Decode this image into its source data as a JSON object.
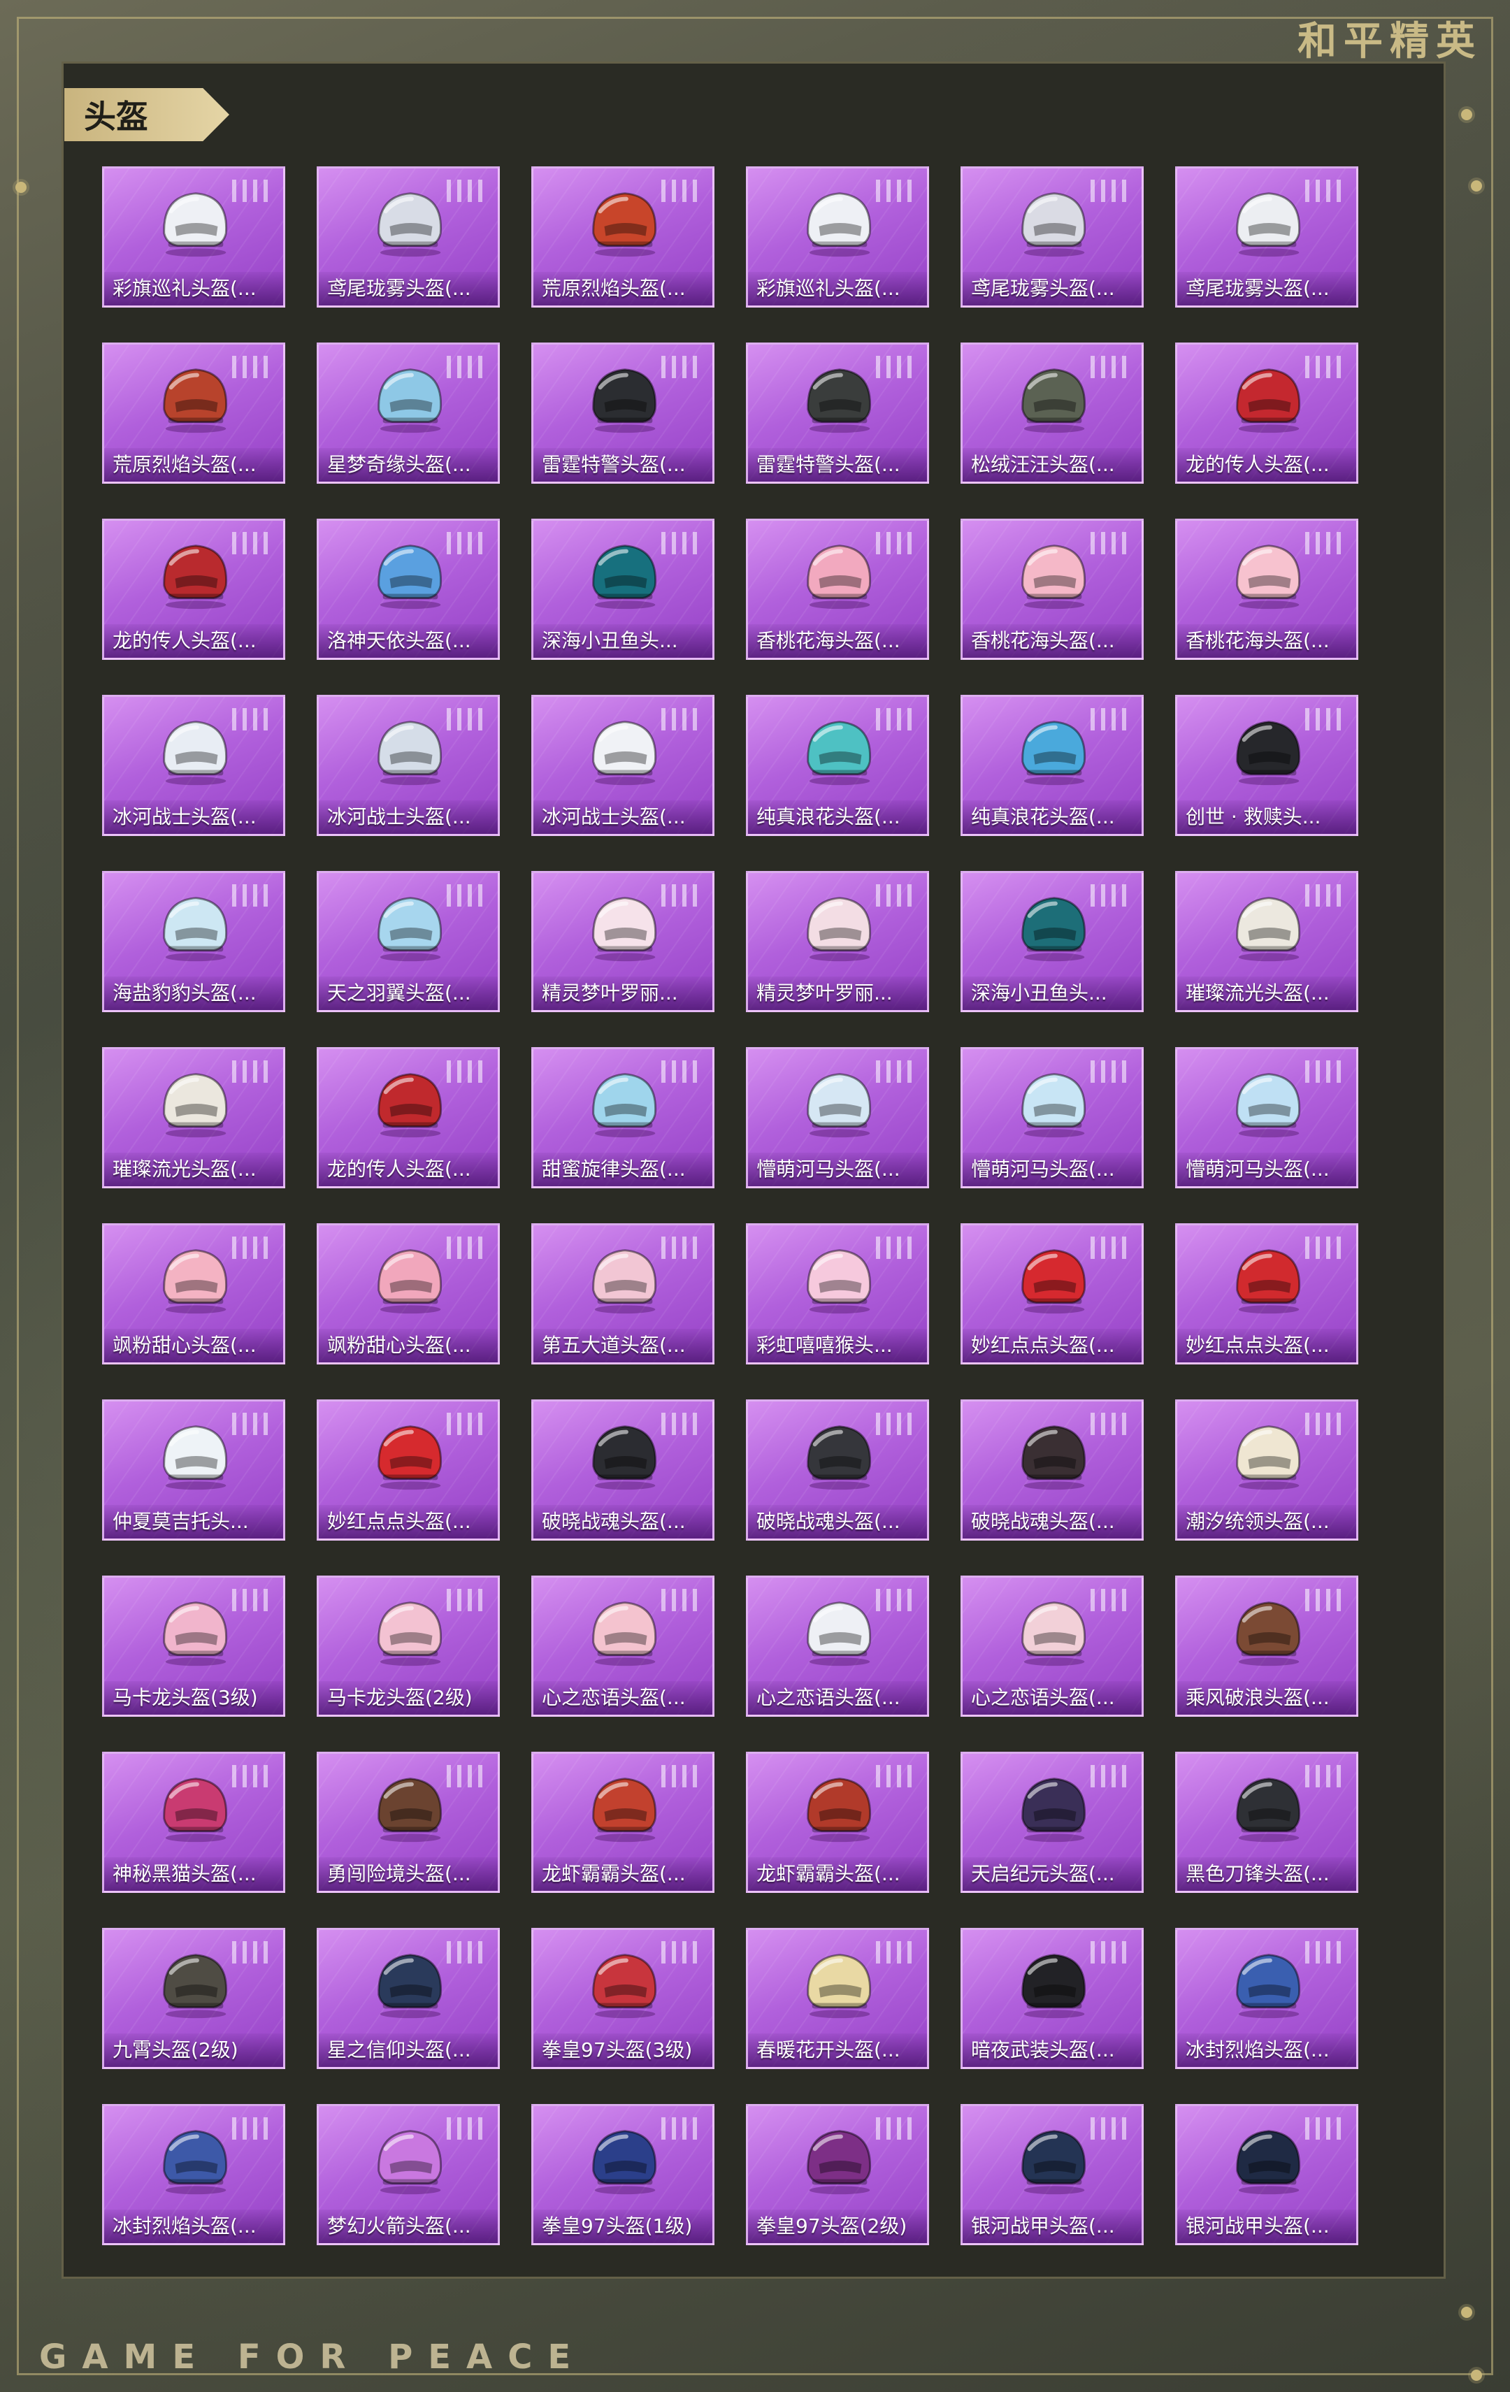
{
  "brand": {
    "title": "和平精英",
    "footer": "GAME FOR PEACE"
  },
  "category": {
    "label": "头盔"
  },
  "colors": {
    "card_base": "#b160dc",
    "panel": "#2a2b24",
    "accent_gold": "#c9b47e"
  },
  "items": [
    {
      "name": "彩旗巡礼头盔(...",
      "color": "#eef0f5"
    },
    {
      "name": "鸢尾珑雾头盔(...",
      "color": "#d8dce6"
    },
    {
      "name": "荒原烈焰头盔(...",
      "color": "#c8452a"
    },
    {
      "name": "彩旗巡礼头盔(...",
      "color": "#eef0f5"
    },
    {
      "name": "鸢尾珑雾头盔(...",
      "color": "#dadbe4"
    },
    {
      "name": "鸢尾珑雾头盔(...",
      "color": "#eceef2"
    },
    {
      "name": "荒原烈焰头盔(...",
      "color": "#b8432c"
    },
    {
      "name": "星梦奇缘头盔(...",
      "color": "#8ec8e6"
    },
    {
      "name": "雷霆特警头盔(...",
      "color": "#2b2d31"
    },
    {
      "name": "雷霆特警头盔(...",
      "color": "#3a3d3c"
    },
    {
      "name": "松绒汪汪头盔(...",
      "color": "#5b6253"
    },
    {
      "name": "龙的传人头盔(...",
      "color": "#c4282f"
    },
    {
      "name": "龙的传人头盔(...",
      "color": "#b92a2e"
    },
    {
      "name": "洛神天依头盔(...",
      "color": "#5aa0e0"
    },
    {
      "name": "深海小丑鱼头...",
      "color": "#17707e"
    },
    {
      "name": "香桃花海头盔(...",
      "color": "#f2a9bf"
    },
    {
      "name": "香桃花海头盔(...",
      "color": "#f5b8c8"
    },
    {
      "name": "香桃花海头盔(...",
      "color": "#f7c2cf"
    },
    {
      "name": "冰河战士头盔(...",
      "color": "#e8edf4"
    },
    {
      "name": "冰河战士头盔(...",
      "color": "#d5dde8"
    },
    {
      "name": "冰河战士头盔(...",
      "color": "#f0f2f6"
    },
    {
      "name": "纯真浪花头盔(...",
      "color": "#4ec1c3"
    },
    {
      "name": "纯真浪花头盔(...",
      "color": "#4aa9dc"
    },
    {
      "name": "创世 · 救赎头...",
      "color": "#26272b"
    },
    {
      "name": "海盐豹豹头盔(...",
      "color": "#cde7f3"
    },
    {
      "name": "天之羽翼头盔(...",
      "color": "#a7d6ee"
    },
    {
      "name": "精灵梦叶罗丽...",
      "color": "#f6e2ea"
    },
    {
      "name": "精灵梦叶罗丽...",
      "color": "#f3dde4"
    },
    {
      "name": "深海小丑鱼头...",
      "color": "#1d6e78"
    },
    {
      "name": "璀璨流光头盔(...",
      "color": "#ece8df"
    },
    {
      "name": "璀璨流光头盔(...",
      "color": "#ebe7de"
    },
    {
      "name": "龙的传人头盔(...",
      "color": "#c0292d"
    },
    {
      "name": "甜蜜旋律头盔(...",
      "color": "#9fd5ec"
    },
    {
      "name": "懵萌河马头盔(...",
      "color": "#d6e7f4"
    },
    {
      "name": "懵萌河马头盔(...",
      "color": "#c8e5f5"
    },
    {
      "name": "懵萌河马头盔(...",
      "color": "#bfe0f4"
    },
    {
      "name": "飒粉甜心头盔(...",
      "color": "#f4b3c3"
    },
    {
      "name": "飒粉甜心头盔(...",
      "color": "#f1a7bc"
    },
    {
      "name": "第五大道头盔(...",
      "color": "#f2c6d4"
    },
    {
      "name": "彩虹嘻嘻猴头...",
      "color": "#f6c9dd"
    },
    {
      "name": "妙红点点头盔(...",
      "color": "#d6292f"
    },
    {
      "name": "妙红点点头盔(...",
      "color": "#d12a2e"
    },
    {
      "name": "仲夏莫吉托头...",
      "color": "#eef3f7"
    },
    {
      "name": "妙红点点头盔(...",
      "color": "#d62a2e"
    },
    {
      "name": "破晓战魂头盔(...",
      "color": "#2b2c31"
    },
    {
      "name": "破晓战魂头盔(...",
      "color": "#35363b"
    },
    {
      "name": "破晓战魂头盔(...",
      "color": "#3a2f33"
    },
    {
      "name": "潮汐统领头盔(...",
      "color": "#efe6d2"
    },
    {
      "name": "马卡龙头盔(3级)",
      "color": "#f1b5cc"
    },
    {
      "name": "马卡龙头盔(2级)",
      "color": "#f3c2d2"
    },
    {
      "name": "心之恋语头盔(...",
      "color": "#f4c3cf"
    },
    {
      "name": "心之恋语头盔(...",
      "color": "#eef0f5"
    },
    {
      "name": "心之恋语头盔(...",
      "color": "#f2d0d8"
    },
    {
      "name": "乘风破浪头盔(...",
      "color": "#7b4a34"
    },
    {
      "name": "神秘黑猫头盔(...",
      "color": "#c93b71"
    },
    {
      "name": "勇闯险境头盔(...",
      "color": "#6b4330"
    },
    {
      "name": "龙虾霸霸头盔(...",
      "color": "#c2412e"
    },
    {
      "name": "龙虾霸霸头盔(...",
      "color": "#b13a2a"
    },
    {
      "name": "天启纪元头盔(...",
      "color": "#3a2f57"
    },
    {
      "name": "黑色刀锋头盔(...",
      "color": "#2e3035"
    },
    {
      "name": "九霄头盔(2级)",
      "color": "#4f4c44"
    },
    {
      "name": "星之信仰头盔(...",
      "color": "#2a3a5b"
    },
    {
      "name": "拳皇97头盔(3级)",
      "color": "#c8353d"
    },
    {
      "name": "春暖花开头盔(...",
      "color": "#e9d9a4"
    },
    {
      "name": "暗夜武装头盔(...",
      "color": "#222226"
    },
    {
      "name": "冰封烈焰头盔(...",
      "color": "#3a5fb0"
    },
    {
      "name": "冰封烈焰头盔(...",
      "color": "#3d59a8"
    },
    {
      "name": "梦幻火箭头盔(...",
      "color": "#c978e0"
    },
    {
      "name": "拳皇97头盔(1级)",
      "color": "#2b3f8a"
    },
    {
      "name": "拳皇97头盔(2级)",
      "color": "#7d2f86"
    },
    {
      "name": "银河战甲头盔(...",
      "color": "#243454"
    },
    {
      "name": "银河战甲头盔(...",
      "color": "#1f2a44"
    }
  ]
}
